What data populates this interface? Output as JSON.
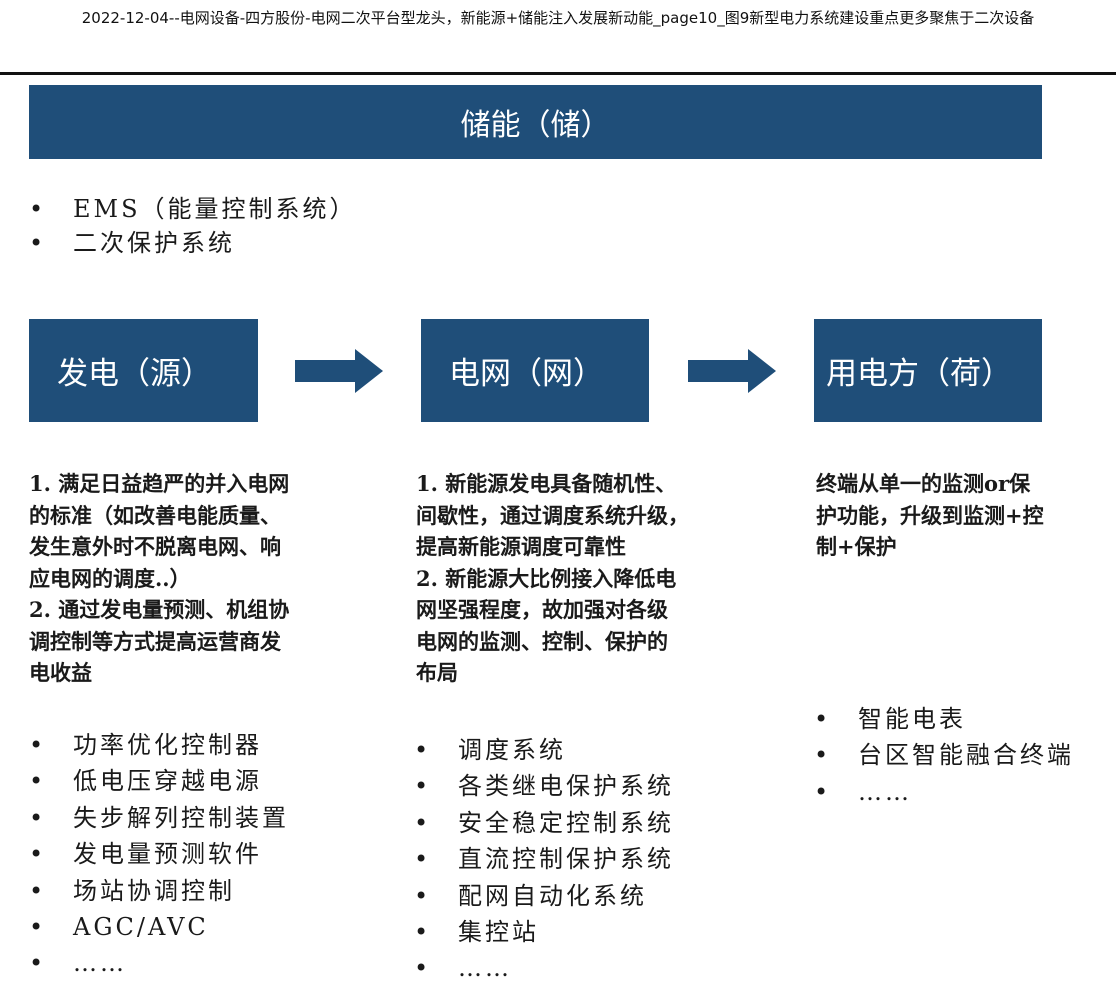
{
  "page": {
    "title": "2022-12-04--电网设备-四方股份-电网二次平台型龙头，新能源+储能注入发展新动能_page10_图9新型电力系统建设重点更多聚焦于二次设备"
  },
  "storage": {
    "header": "储能（储）",
    "items": [
      "EMS（能量控制系统）",
      "二次保护系统"
    ]
  },
  "stages": {
    "source": {
      "title": "发电（源）",
      "description": "1. 满足日益趋严的并入电网\n的标准（如改善电能质量、\n发生意外时不脱离电网、响\n应电网的调度..）\n2. 通过发电量预测、机组协\n调控制等方式提高运营商发\n电收益",
      "items": [
        "功率优化控制器",
        "低电压穿越电源",
        "失步解列控制装置",
        "发电量预测软件",
        "场站协调控制",
        "AGC/AVC",
        "……"
      ]
    },
    "grid": {
      "title": "电网（网）",
      "description": "1. 新能源发电具备随机性、\n间歇性，通过调度系统升级，\n提高新能源调度可靠性\n2. 新能源大比例接入降低电\n网坚强程度，故加强对各级\n电网的监测、控制、保护的\n布局",
      "items": [
        "调度系统",
        "各类继电保护系统",
        "安全稳定控制系统",
        "直流控制保护系统",
        "配网自动化系统",
        "集控站",
        "……"
      ]
    },
    "load": {
      "title": "用电方（荷）",
      "description": "终端从单一的监测or保\n护功能，升级到监测+控\n制+保护",
      "items": [
        "智能电表",
        "台区智能融合终端",
        "……"
      ]
    }
  },
  "colors": {
    "box_fill": "#1f4e79",
    "box_text": "#ffffff",
    "arrow": "#1f4e79",
    "body_text": "#1a1a1a"
  }
}
